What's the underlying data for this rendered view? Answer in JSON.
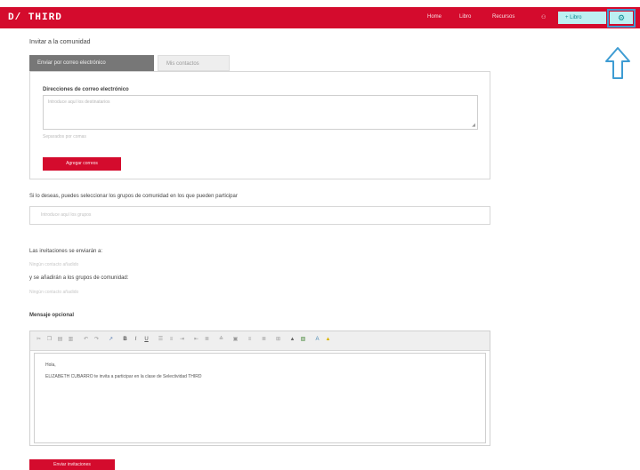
{
  "header": {
    "logo": "D/ THIRD",
    "nav": [
      "Home",
      "Libro",
      "Recursos"
    ],
    "user_icon": "person-icon",
    "libro_button": "+ Libro",
    "settings_icon": "gear-icon"
  },
  "annotation": {
    "arrow": "up-arrow-icon"
  },
  "page_title": "Invitar a la comunidad",
  "tabs": [
    {
      "label": "Enviar por correo electrónico",
      "active": true
    },
    {
      "label": "Mis contactos",
      "active": false
    }
  ],
  "email_form": {
    "label": "Direcciones de correo electrónico",
    "placeholder": "Introduce aquí los destinatarios",
    "help": "Separados por comas",
    "add_button": "Agregar correos"
  },
  "groups": {
    "question": "Si lo deseas, puedes seleccionar los grupos de comunidad en los que pueden participar",
    "placeholder": "Introduce aquí los grupos"
  },
  "sent_to": {
    "label": "Las invitaciones se enviarán a:",
    "contacts_link": "Ningún contacto añadido",
    "groups_label": "y se añadirán a los grupos de comunidad:",
    "groups_link": "Ningún contacto añadido"
  },
  "message": {
    "label": "Mensaje opcional",
    "greeting": "Hola,",
    "body": "ELIZABETH CUBARRO te invita a participar en la clase de Selectividad THIRD"
  },
  "toolbar_icons": [
    "cut-icon",
    "copy-icon",
    "paste-icon",
    "paste-text-icon",
    "undo-icon",
    "redo-icon",
    "link-icon",
    "bold-icon",
    "italic-icon",
    "underline-icon",
    "ordered-list-icon",
    "unordered-list-icon",
    "indent-icon",
    "outdent-icon",
    "align-left-icon",
    "align-center-icon",
    "image-icon",
    "align-right-icon",
    "justify-icon",
    "table-icon",
    "emoji-icon",
    "image-upload-icon",
    "text-color-icon",
    "background-color-icon"
  ],
  "send_button": "Enviar invitaciones",
  "colors": {
    "brand": "#d40b2d",
    "accent": "#bdf0f2",
    "highlight": "#3e9cd3"
  }
}
